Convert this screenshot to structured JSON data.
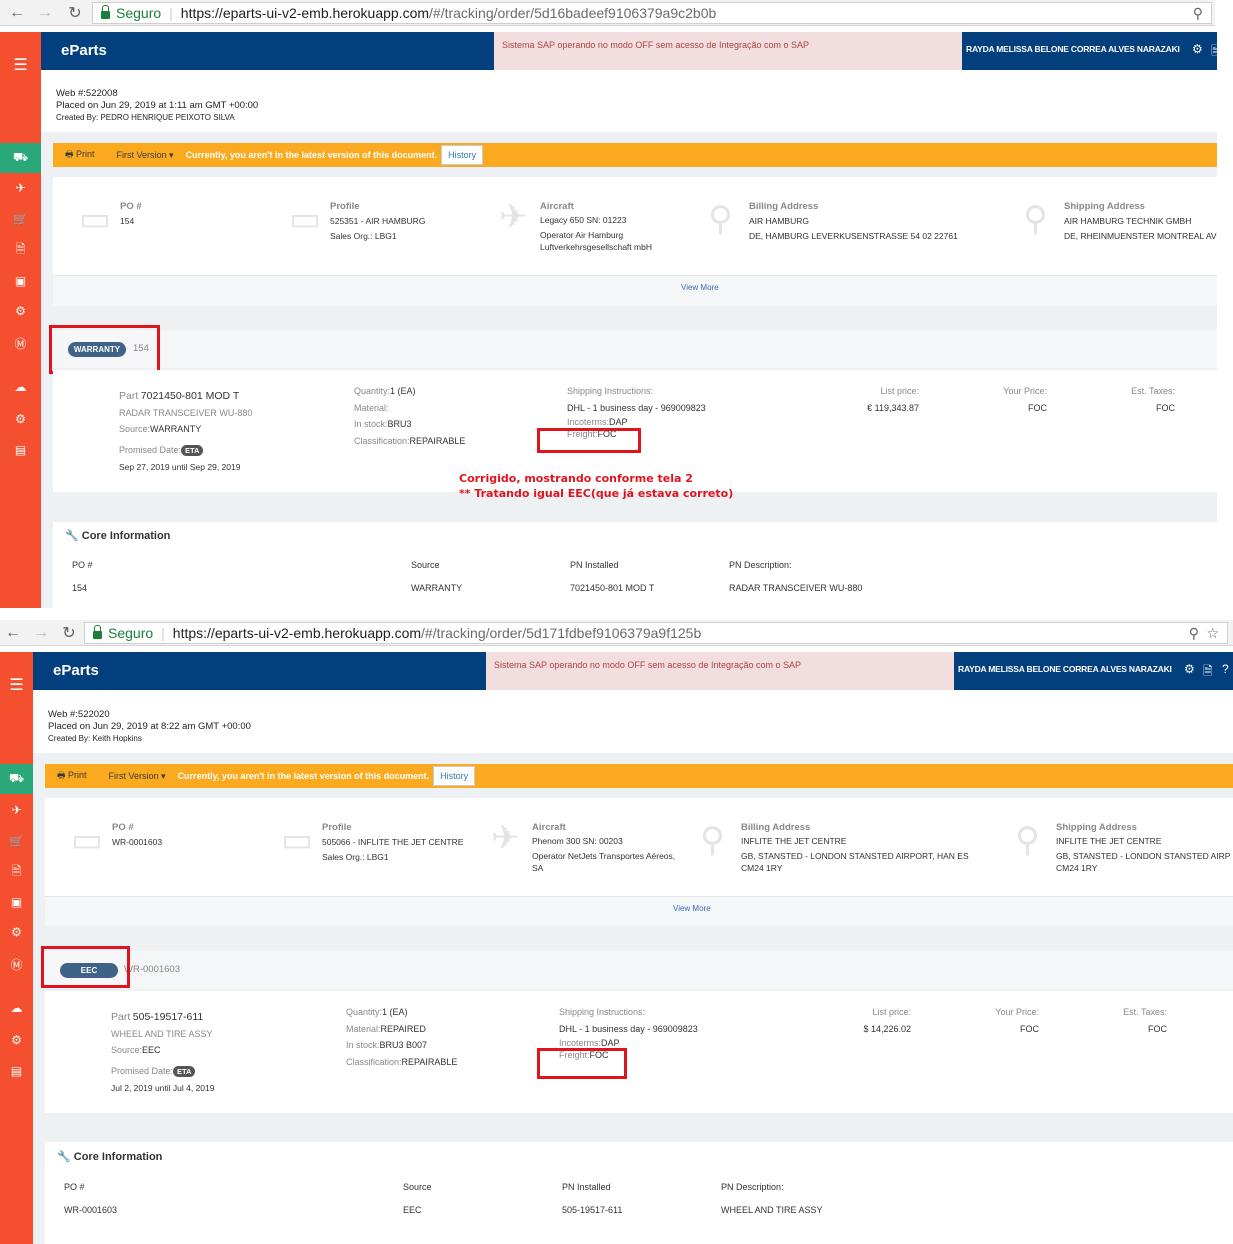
{
  "shots": [
    {
      "browser": {
        "secure_label": "Seguro",
        "url_host": "https://eparts-ui-v2-emb.herokuapp.com",
        "url_path": "/#/tracking/order/5d16badeef9106379a9c2b0b"
      },
      "app": {
        "logo": "eParts",
        "alert": "Sistema SAP operando no modo OFF sem acesso de Integração com o SAP",
        "user": "RAYDA MELISSA BELONE CORREA ALVES NARAZAKI"
      },
      "order": {
        "web": "Web #:522008",
        "placed": "Placed on Jun 29, 2019 at 1:11 am GMT +00:00",
        "created_by": "Created By: PEDRO HENRIQUE PEIXOTO SILVA"
      },
      "toolbar": {
        "print": "Print",
        "version": "First Version",
        "message": "Currently, you aren't in the latest version of this document.",
        "history": "History"
      },
      "info": {
        "po_title": "PO #",
        "po_value": "154",
        "profile_title": "Profile",
        "profile_line1": "525351 - AIR HAMBURG",
        "profile_line2": "Sales Org.: LBG1",
        "aircraft_title": "Aircraft",
        "aircraft_line1": "Legacy 650 SN: 01223",
        "aircraft_line2": "Operator Air Hamburg",
        "aircraft_line3": "Luftverkehrsgesellschaft mbH",
        "billing_title": "Billing Address",
        "billing_line1": "AIR HAMBURG",
        "billing_line2": "DE, HAMBURG LEVERKUSENSTRASSE 54 02 22761",
        "billing_line3": "",
        "shipping_title": "Shipping Address",
        "shipping_line1": "AIR HAMBURG TECHNIK GMBH",
        "shipping_line2": "DE, RHEINMUENSTER MONTREAL AV",
        "shipping_line3": "",
        "view_more": "View More"
      },
      "section": {
        "badge": "WARRANTY",
        "ref": "154"
      },
      "part": {
        "part_label": "Part",
        "part_number": "7021450-801 MOD T",
        "description": "RADAR TRANSCEIVER WU-880",
        "source_label": "Source:",
        "source_value": "WARRANTY",
        "promised_label": "Promised Date:",
        "eta": "ETA",
        "dates": "Sep 27, 2019 until Sep 29, 2019",
        "quantity_label": "Quantity:",
        "quantity_value": "1 (EA)",
        "material_label": "Material:",
        "material_value": "",
        "stock_label": "In stock:",
        "stock_value": "BRU3",
        "class_label": "Classification:",
        "class_value": "REPAIRABLE",
        "ship_instr_label": "Shipping Instructions:",
        "ship_instr_value": "DHL - 1 business day - 969009823",
        "incoterms_label": "Incoterms:",
        "incoterms_value": "DAP",
        "freight_label": "Freight:",
        "freight_value": "FOC",
        "list_price_label": "List price:",
        "list_price_value": "€ 119,343.87",
        "your_price_label": "Your Price:",
        "your_price_value": "FOC",
        "taxes_label": "Est. Taxes:",
        "taxes_value": "FOC"
      },
      "core": {
        "title": "Core Information",
        "headers": [
          "PO #",
          "Source",
          "PN Installed",
          "PN Description:"
        ],
        "values": [
          "154",
          "WARRANTY",
          "7021450-801 MOD T",
          "RADAR TRANSCEIVER WU-880"
        ]
      }
    },
    {
      "browser": {
        "secure_label": "Seguro",
        "url_host": "https://eparts-ui-v2-emb.herokuapp.com",
        "url_path": "/#/tracking/order/5d171fdbef9106379a9f125b"
      },
      "app": {
        "logo": "eParts",
        "alert": "Sistema SAP operando no modo OFF sem acesso de Integração com o SAP",
        "user": "RAYDA MELISSA BELONE CORREA ALVES NARAZAKI"
      },
      "order": {
        "web": "Web #:522020",
        "placed": "Placed on Jun 29, 2019 at 8:22 am GMT +00:00",
        "created_by": "Created By: Keith Hopkins"
      },
      "toolbar": {
        "print": "Print",
        "version": "First Version",
        "message": "Currently, you aren't in the latest version of this document.",
        "history": "History"
      },
      "info": {
        "po_title": "PO #",
        "po_value": "WR-0001603",
        "profile_title": "Profile",
        "profile_line1": "505066 - INFLITE THE JET CENTRE",
        "profile_line2": "Sales Org.: LBG1",
        "aircraft_title": "Aircraft",
        "aircraft_line1": "Phenom 300 SN: 00203",
        "aircraft_line2": "Operator NetJets Transportes Aéreos,",
        "aircraft_line3": "SA",
        "billing_title": "Billing Address",
        "billing_line1": "INFLITE THE JET CENTRE",
        "billing_line2": "GB, STANSTED - LONDON STANSTED AIRPORT, HAN ES",
        "billing_line3": "CM24 1RY",
        "shipping_title": "Shipping Address",
        "shipping_line1": "INFLITE THE JET CENTRE",
        "shipping_line2": "GB, STANSTED - LONDON STANSTED AIRP",
        "shipping_line3": "CM24 1RY",
        "view_more": "View More"
      },
      "section": {
        "badge": "EEC",
        "ref": "WR-0001603"
      },
      "part": {
        "part_label": "Part",
        "part_number": "505-19517-611",
        "description": "WHEEL AND TIRE ASSY",
        "source_label": "Source:",
        "source_value": "EEC",
        "promised_label": "Promised Date:",
        "eta": "ETA",
        "dates": "Jul 2, 2019 until Jul 4, 2019",
        "quantity_label": "Quantity:",
        "quantity_value": "1 (EA)",
        "material_label": "Material:",
        "material_value": "REPAIRED",
        "stock_label": "In stock:",
        "stock_value": "BRU3 B007",
        "class_label": "Classification:",
        "class_value": "REPAIRABLE",
        "ship_instr_label": "Shipping Instructions:",
        "ship_instr_value": "DHL - 1 business day - 969009823",
        "incoterms_label": "Incoterms:",
        "incoterms_value": "DAP",
        "freight_label": "Freight:",
        "freight_value": "FOC",
        "list_price_label": "List price:",
        "list_price_value": "$ 14,226.02",
        "your_price_label": "Your Price:",
        "your_price_value": "FOC",
        "taxes_label": "Est. Taxes:",
        "taxes_value": "FOC"
      },
      "core": {
        "title": "Core Information",
        "headers": [
          "PO #",
          "Source",
          "PN Installed",
          "PN Description:"
        ],
        "values": [
          "WR-0001603",
          "EEC",
          "505-19517-611",
          "WHEEL AND TIRE ASSY"
        ]
      }
    }
  ],
  "annotation": {
    "line1": "Corrigido, mostrando conforme tela 2",
    "line2": "** Tratando igual EEC(que já estava correto)"
  },
  "colors": {
    "sidebar": "#f4502f",
    "sidebar_active": "#2ba879",
    "topbar": "#033f7d",
    "toolbar": "#fbaa1f",
    "badge": "#3f6388",
    "highlight": "#e0141e"
  }
}
